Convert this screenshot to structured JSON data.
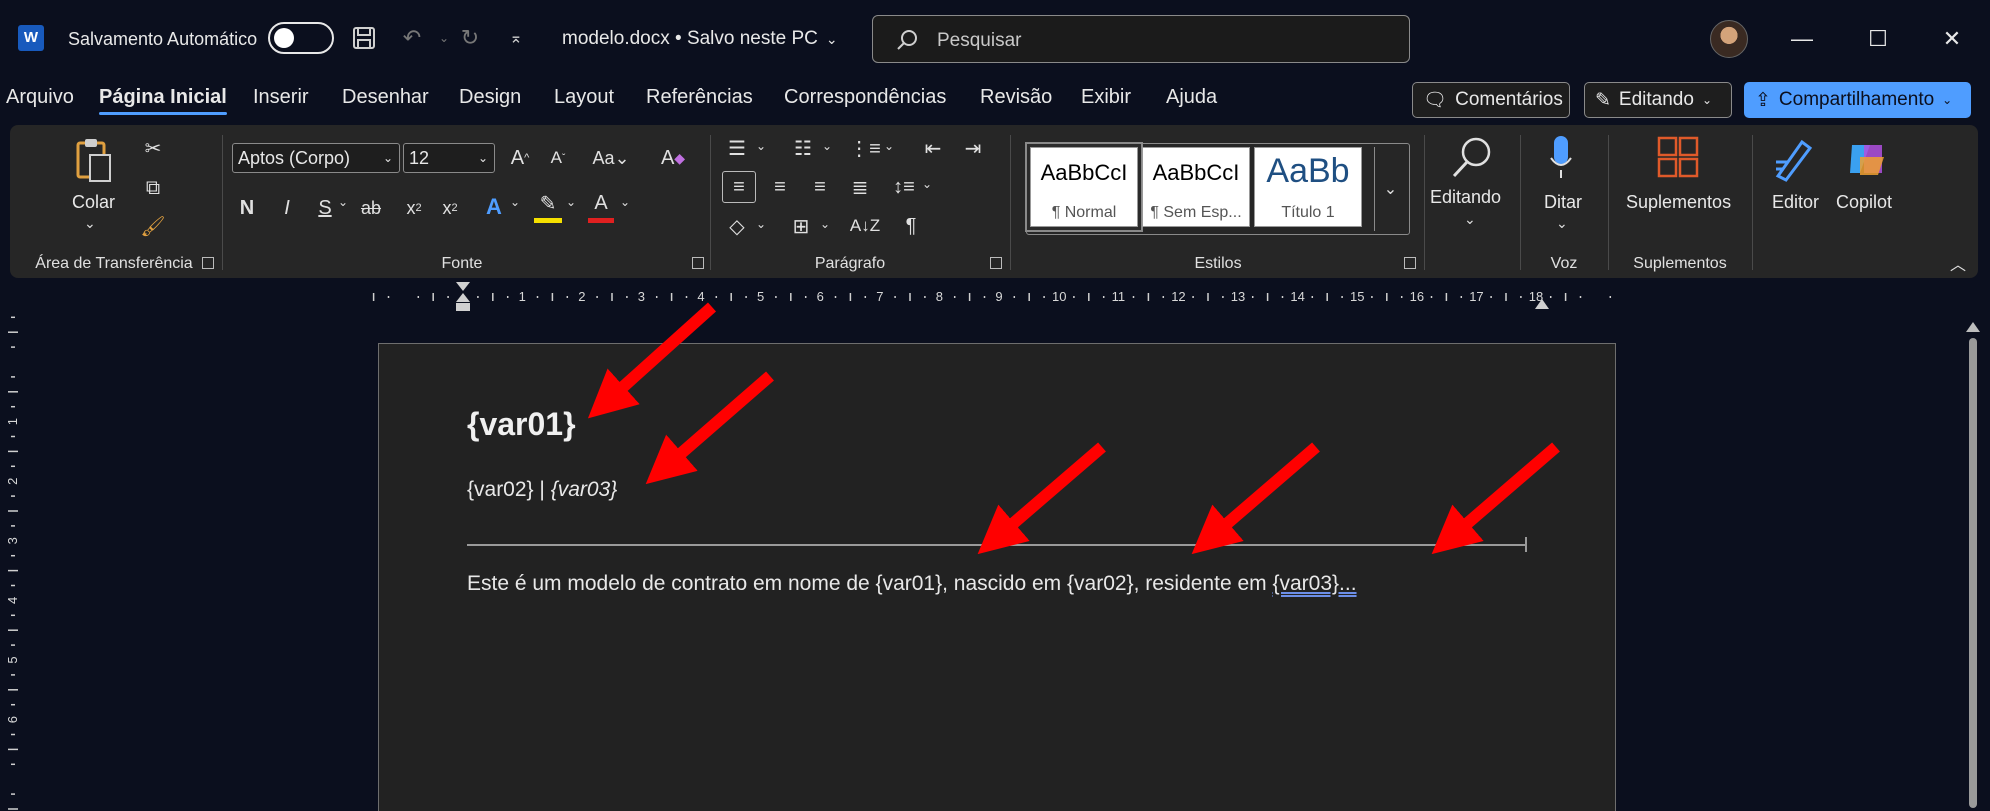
{
  "titlebar": {
    "app_icon": "W",
    "autosave_label": "Salvamento Automático",
    "doc_title": "modelo.docx • Salvo neste PC",
    "search_placeholder": "Pesquisar",
    "icons": [
      "save-icon",
      "undo-icon",
      "redo-icon",
      "customize-qat-icon"
    ]
  },
  "menu": {
    "tabs": [
      "Arquivo",
      "Página Inicial",
      "Inserir",
      "Desenhar",
      "Design",
      "Layout",
      "Referências",
      "Correspondências",
      "Revisão",
      "Exibir",
      "Ajuda"
    ],
    "active_tab": "Página Inicial",
    "comments_label": "Comentários",
    "editing_label": "Editando",
    "share_label": "Compartilhamento"
  },
  "ribbon": {
    "clipboard": {
      "paste_label": "Colar",
      "group_label": "Área de Transferência"
    },
    "font": {
      "font_name": "Aptos (Corpo)",
      "font_size": "12",
      "bold": "N",
      "italic": "I",
      "strike": "S",
      "group_label": "Fonte"
    },
    "paragraph": {
      "group_label": "Parágrafo"
    },
    "styles": {
      "items": [
        {
          "sample": "AaBbCcI",
          "name": "¶ Normal"
        },
        {
          "sample": "AaBbCcI",
          "name": "¶ Sem Esp..."
        },
        {
          "sample": "AaBb",
          "name": "Título 1"
        }
      ],
      "group_label": "Estilos"
    },
    "editing": {
      "label": "Editando"
    },
    "voice": {
      "label": "Ditar",
      "group_label": "Voz"
    },
    "addins": {
      "label": "Suplementos",
      "group_label": "Suplementos"
    },
    "editor_label": "Editor",
    "copilot_label": "Copilot"
  },
  "ruler": {
    "numbers": [
      "1",
      "2",
      "3",
      "4",
      "5",
      "6",
      "7",
      "8",
      "9",
      "10",
      "11",
      "12",
      "13",
      "14",
      "15",
      "16",
      "17",
      "18"
    ],
    "vertical_numbers": [
      "1",
      "2",
      "3",
      "4",
      "5",
      "6"
    ]
  },
  "document": {
    "title": "{var01}",
    "subtitle_a": "{var02}",
    "subtitle_sep": " | ",
    "subtitle_b": "{var03}",
    "body_prefix": "Este é um modelo de contrato em nome de {var01}, nascido em {var02}, residente em ",
    "body_marked": "{var03}...",
    "annotation_arrow_color": "#ff0000"
  }
}
